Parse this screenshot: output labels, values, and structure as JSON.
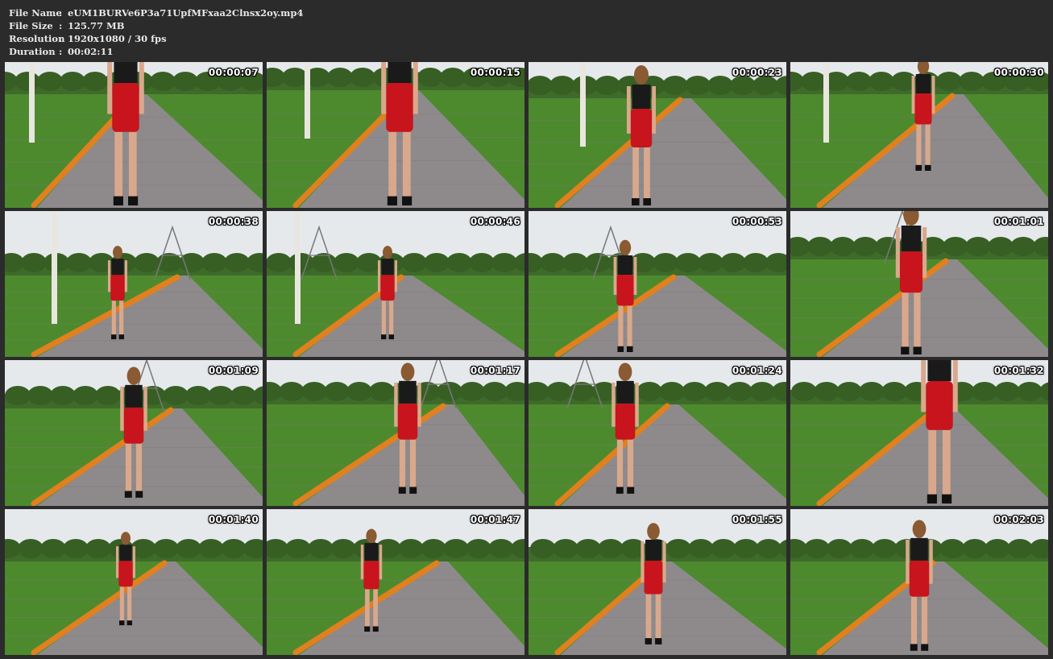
{
  "info": {
    "file_name_label": "File Name",
    "file_name_value": "eUM1BURVe6P3a71UpfMFxaa2Clnsx2oy.mp4",
    "file_size_label": "File Size",
    "file_size_value": "125.77 MB",
    "resolution_label": "Resolution",
    "resolution_value": "1920x1080 / 30 fps",
    "duration_label": "Duration",
    "duration_value": "00:02:11",
    "separator": ":"
  },
  "colors": {
    "background": "#2b2b2b",
    "sky": "#e6e9ec",
    "grass": "#4d8a2e",
    "path": "#8e8a8c",
    "flowers": "#e0801e",
    "skirt": "#c8141c",
    "top": "#1a1a1a",
    "skin": "#d9a88c"
  },
  "thumbnails": [
    {
      "timestamp": "00:00:07"
    },
    {
      "timestamp": "00:00:15"
    },
    {
      "timestamp": "00:00:23"
    },
    {
      "timestamp": "00:00:30"
    },
    {
      "timestamp": "00:00:38"
    },
    {
      "timestamp": "00:00:46"
    },
    {
      "timestamp": "00:00:53"
    },
    {
      "timestamp": "00:01:01"
    },
    {
      "timestamp": "00:01:09"
    },
    {
      "timestamp": "00:01:17"
    },
    {
      "timestamp": "00:01:24"
    },
    {
      "timestamp": "00:01:32"
    },
    {
      "timestamp": "00:01:40"
    },
    {
      "timestamp": "00:01:47"
    },
    {
      "timestamp": "00:01:55"
    },
    {
      "timestamp": "00:02:03"
    }
  ]
}
